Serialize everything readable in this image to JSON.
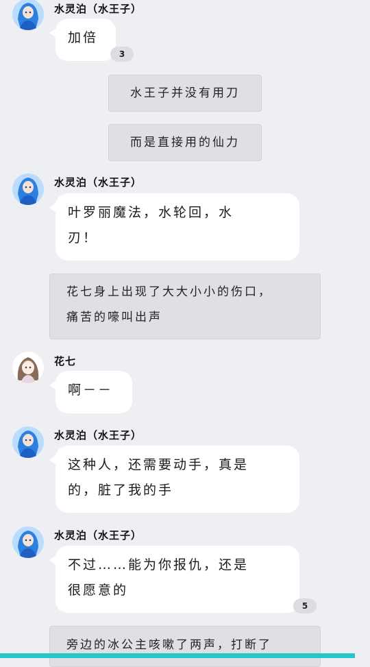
{
  "messages": [
    {
      "type": "chat",
      "speaker": "水灵泊（水王子）",
      "avatar": "water-prince-avatar",
      "text": "加倍",
      "reaction_count": "3"
    },
    {
      "type": "narration",
      "text": "水王子并没有用刀"
    },
    {
      "type": "narration",
      "text": "而是直接用的仙力"
    },
    {
      "type": "chat",
      "speaker": "水灵泊（水王子）",
      "avatar": "water-prince-avatar",
      "line1": "叶罗丽魔法，水轮回，水",
      "line2": "刃！"
    },
    {
      "type": "narration",
      "line1": "花七身上出现了大大小小的伤口，",
      "line2": "痛苦的嚎叫出声"
    },
    {
      "type": "chat",
      "speaker": "花七",
      "avatar": "hua-qi-avatar",
      "text": "啊－－"
    },
    {
      "type": "chat",
      "speaker": "水灵泊（水王子）",
      "avatar": "water-prince-avatar",
      "line1": "这种人，还需要动手，真是",
      "line2": "的，脏了我的手"
    },
    {
      "type": "chat",
      "speaker": "水灵泊（水王子）",
      "avatar": "water-prince-avatar",
      "line1": "不过……能为你报仇，还是",
      "line2": "很愿意的",
      "reaction_count": "5"
    },
    {
      "type": "narration",
      "text": "旁边的冰公主咳嗽了两声，打断了"
    }
  ],
  "colors": {
    "background": "#eeeff3",
    "bubble": "#ffffff",
    "narration": "#dfe0e4",
    "bottom_bar": "#27c6c9"
  }
}
